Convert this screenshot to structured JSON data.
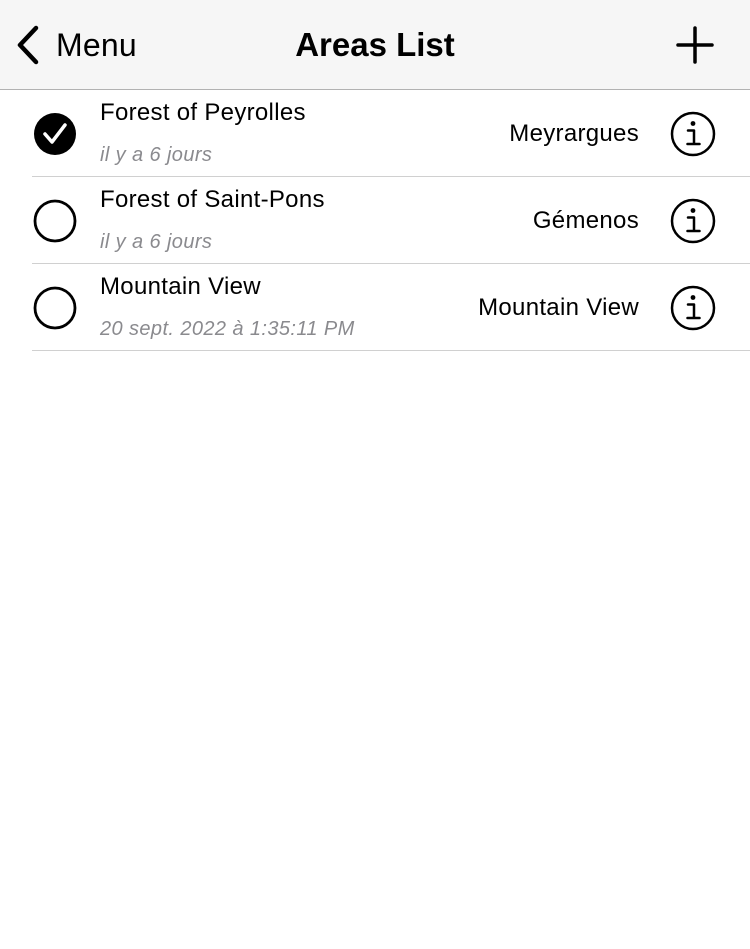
{
  "nav": {
    "back_label": "Menu",
    "title": "Areas List",
    "back_icon": "chevron-left-icon",
    "add_icon": "plus-icon"
  },
  "areas": [
    {
      "name": "Forest of Peyrolles",
      "date": "il y a 6 jours",
      "location": "Meyrargues",
      "selected": true
    },
    {
      "name": "Forest of Saint-Pons",
      "date": "il y a 6 jours",
      "location": "Gémenos",
      "selected": false
    },
    {
      "name": "Mountain View",
      "date": "20 sept. 2022 à 1:35:11 PM",
      "location": "Mountain View",
      "selected": false
    }
  ],
  "colors": {
    "nav_background": "#f6f6f6",
    "secondary_text": "#8a8a8e",
    "separator": "#d0d0d0"
  }
}
